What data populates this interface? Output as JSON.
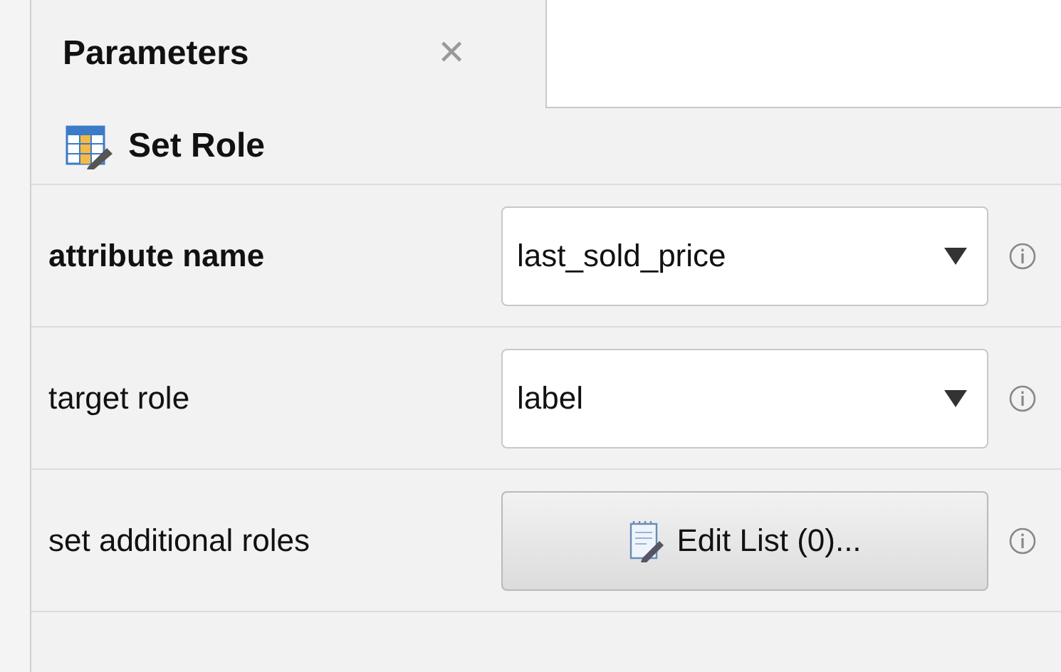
{
  "tabs": [
    {
      "label": "Parameters",
      "close": "✕",
      "selected": true
    }
  ],
  "operator": {
    "name": "Set Role"
  },
  "parameters": [
    {
      "kind": "dropdown",
      "label": "attribute name",
      "bold": true,
      "value": "last_sold_price"
    },
    {
      "kind": "dropdown",
      "label": "target role",
      "bold": false,
      "value": "label"
    },
    {
      "kind": "button",
      "label": "set additional roles",
      "bold": false,
      "value": "Edit List (0)..."
    }
  ]
}
